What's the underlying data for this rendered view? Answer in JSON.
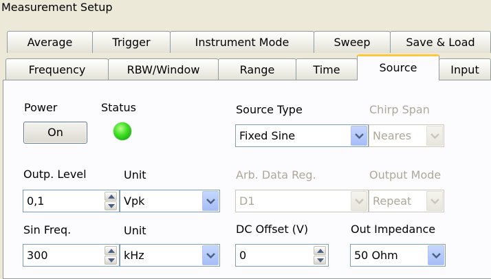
{
  "window": {
    "title": "Measurement Setup"
  },
  "tabs_row1": [
    "Average",
    "Trigger",
    "Instrument Mode",
    "Sweep",
    "Save & Load"
  ],
  "tabs_row2": [
    "Frequency",
    "RBW/Window",
    "Range",
    "Time",
    "Source",
    "Input"
  ],
  "active_tab": "Source",
  "power": {
    "label": "Power",
    "button": "On"
  },
  "status": {
    "label": "Status",
    "led_color": "#3ad11f",
    "state": "on"
  },
  "source_type": {
    "label": "Source Type",
    "value": "Fixed Sine",
    "enabled": true
  },
  "chirp_span": {
    "label": "Chirp Span",
    "value": "Neares",
    "enabled": false
  },
  "output_level": {
    "label": "Outp. Level",
    "value": "0,1"
  },
  "output_level_unit": {
    "label": "Unit",
    "value": "Vpk"
  },
  "arb_data_reg": {
    "label": "Arb. Data Reg.",
    "value": "D1",
    "enabled": false
  },
  "output_mode": {
    "label": "Output Mode",
    "value": "Repeat",
    "enabled": false
  },
  "sin_freq": {
    "label": "Sin Freq.",
    "value": "300"
  },
  "sin_freq_unit": {
    "label": "Unit",
    "value": "kHz"
  },
  "dc_offset": {
    "label": "DC Offset (V)",
    "value": "0"
  },
  "out_impedance": {
    "label": "Out Impedance",
    "value": "50 Ohm"
  },
  "colors": {
    "accent_tab": "#ffc83c",
    "dropdown_button": "#b6c9fa",
    "disabled_text": "#aca899"
  }
}
